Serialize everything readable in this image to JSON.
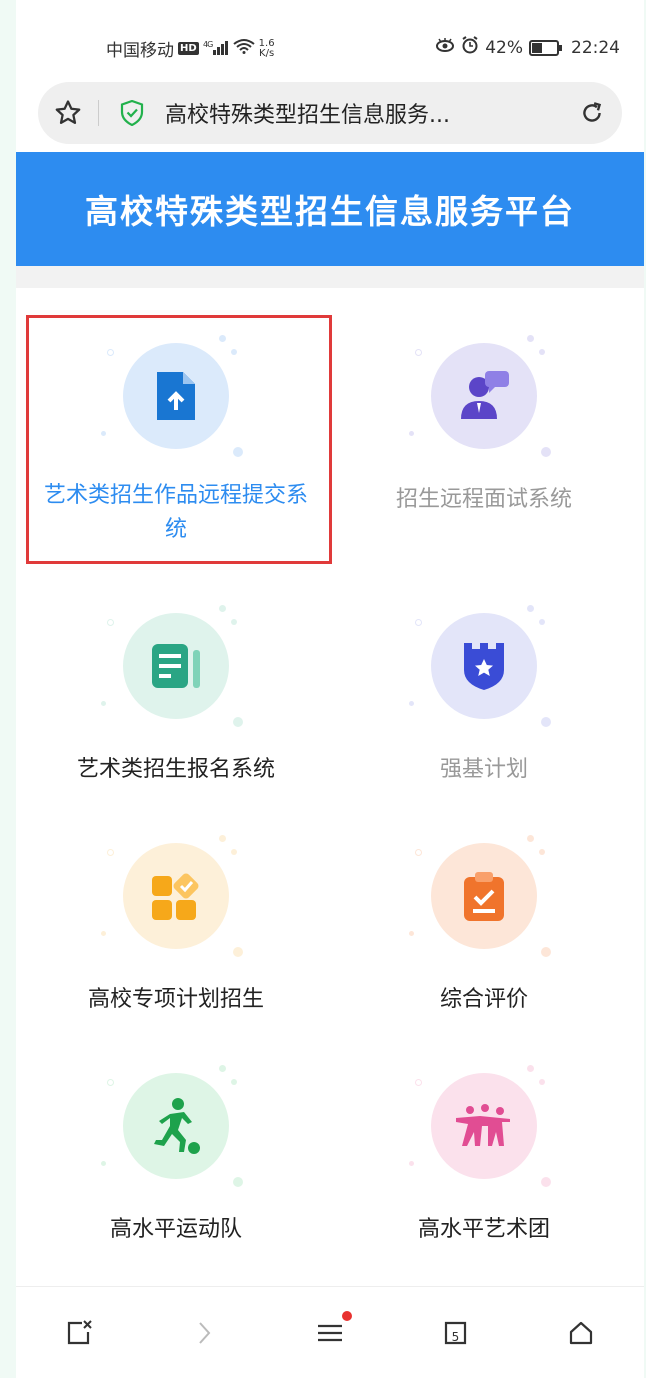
{
  "status_bar": {
    "carrier": "中国移动",
    "hd": "HD",
    "network": "4G",
    "speed_value": "1.6",
    "speed_unit": "K/s",
    "battery": "42%",
    "battery_level": 0.42,
    "time": "22:24"
  },
  "browser": {
    "url_title": "高校特殊类型招生信息服务..."
  },
  "banner": {
    "title": "高校特殊类型招生信息服务平台"
  },
  "tiles": [
    {
      "label": "艺术类招生作品远程提交系统",
      "icon": "file-upload-icon",
      "circle": "#dbeafb",
      "icon_color": "#1976d2",
      "state": "selected"
    },
    {
      "label": "招生远程面试系统",
      "icon": "interview-icon",
      "circle": "#e4e2f7",
      "icon_color": "#5b45c8",
      "state": "disabled"
    },
    {
      "label": "艺术类招生报名系统",
      "icon": "form-icon",
      "circle": "#dff3ec",
      "icon_color": "#2aa584",
      "state": "normal"
    },
    {
      "label": "强基计划",
      "icon": "shield-star-icon",
      "circle": "#e3e5f9",
      "icon_color": "#3a4cd6",
      "state": "disabled"
    },
    {
      "label": "高校专项计划招生",
      "icon": "apps-icon",
      "circle": "#fdf0d9",
      "icon_color": "#f6a81a",
      "state": "normal"
    },
    {
      "label": "综合评价",
      "icon": "clipboard-check-icon",
      "circle": "#fde6d8",
      "icon_color": "#f0742c",
      "state": "normal"
    },
    {
      "label": "高水平运动队",
      "icon": "soccer-player-icon",
      "circle": "#def5e6",
      "icon_color": "#1ea24c",
      "state": "normal"
    },
    {
      "label": "高水平艺术团",
      "icon": "dancers-icon",
      "circle": "#fbe1ec",
      "icon_color": "#e14d93",
      "state": "normal"
    }
  ],
  "bottom_bar": {
    "tabs_count": "5"
  }
}
